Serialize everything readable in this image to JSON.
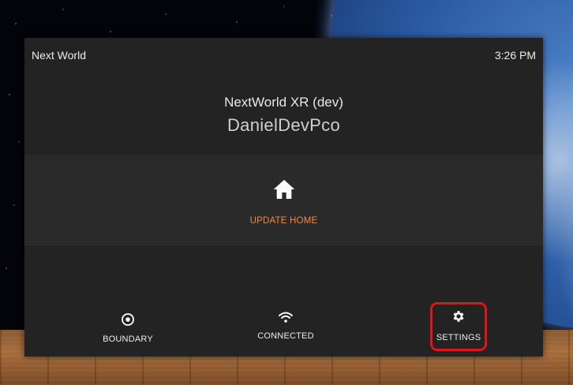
{
  "status_bar": {
    "title": "Next World",
    "time": "3:26 PM"
  },
  "header": {
    "app_name": "NextWorld XR (dev)",
    "device_name": "DanielDevPco"
  },
  "home_section": {
    "icon": "home-icon",
    "action_label": "UPDATE HOME",
    "accent_color": "#f08a3c"
  },
  "actions": [
    {
      "icon": "target-circle-icon",
      "label": "BOUNDARY"
    },
    {
      "icon": "wifi-icon",
      "label": "CONNECTED"
    },
    {
      "icon": "gear-icon",
      "label": "SETTINGS",
      "highlighted": true
    }
  ],
  "highlight_color": "#e5121a"
}
